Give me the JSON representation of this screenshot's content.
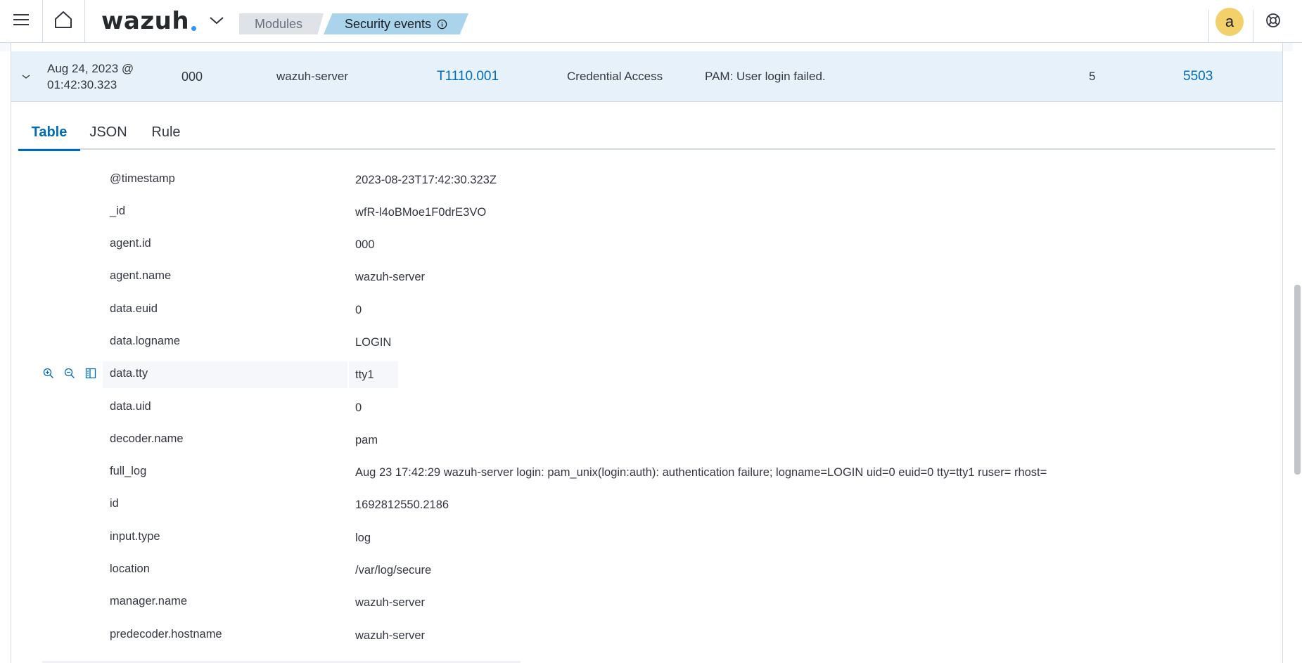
{
  "header": {
    "logo_text": "wazuh",
    "breadcrumbs": [
      "Modules",
      "Security events"
    ],
    "avatar_initial": "a",
    "icons": {
      "menu": "hamburger-menu-icon",
      "home": "home-icon",
      "app_menu": "chevron-down-icon",
      "info": "info-icon",
      "help": "help-lifebuoy-icon"
    },
    "accent_color": "#3595f9"
  },
  "event": {
    "time_line1": "Aug 24, 2023 @",
    "time_line2": "01:42:30.323",
    "agent_id": "000",
    "agent_name": "wazuh-server",
    "technique": "T1110.001",
    "tactic": "Credential Access",
    "description": "PAM: User login failed.",
    "level": "5",
    "rule_id": "5503"
  },
  "tabs": [
    "Table",
    "JSON",
    "Rule"
  ],
  "active_tab": "Table",
  "fields": [
    {
      "name": "@timestamp",
      "value": "2023-08-23T17:42:30.323Z"
    },
    {
      "name": "_id",
      "value": "wfR-l4oBMoe1F0drE3VO"
    },
    {
      "name": "agent.id",
      "value": "000"
    },
    {
      "name": "agent.name",
      "value": "wazuh-server"
    },
    {
      "name": "data.euid",
      "value": "0"
    },
    {
      "name": "data.logname",
      "value": "LOGIN"
    },
    {
      "name": "data.tty",
      "value": "tty1"
    },
    {
      "name": "data.uid",
      "value": "0"
    },
    {
      "name": "decoder.name",
      "value": "pam"
    },
    {
      "name": "full_log",
      "value": "Aug 23 17:42:29 wazuh-server login: pam_unix(login:auth): authentication failure; logname=LOGIN uid=0 euid=0 tty=tty1 ruser= rhost="
    },
    {
      "name": "id",
      "value": "1692812550.2186"
    },
    {
      "name": "input.type",
      "value": "log"
    },
    {
      "name": "location",
      "value": "/var/log/secure"
    },
    {
      "name": "manager.name",
      "value": "wazuh-server"
    },
    {
      "name": "predecoder.hostname",
      "value": "wazuh-server"
    }
  ],
  "field_action_icons": [
    "zoom-in-icon",
    "zoom-out-icon",
    "toggle-column-icon"
  ]
}
